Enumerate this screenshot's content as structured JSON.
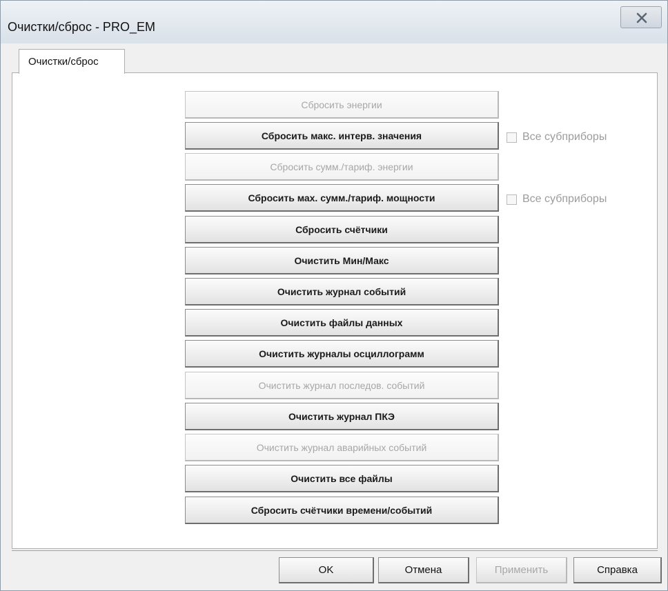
{
  "window": {
    "title": "Очистки/сброс - PRO_EM",
    "close_icon": "close-x-icon"
  },
  "tabs": [
    {
      "label": "Очистки/сброс",
      "active": true
    }
  ],
  "actions": [
    {
      "label": "Сбросить энергии",
      "enabled": false
    },
    {
      "label": "Сбросить макс. интерв. значения",
      "enabled": true
    },
    {
      "label": "Сбросить сумм./тариф. энергии",
      "enabled": false
    },
    {
      "label": "Сбросить мах. сумм./тариф. мощности",
      "enabled": true
    },
    {
      "label": "Сбросить счётчики",
      "enabled": true
    },
    {
      "label": "Очистить Мин/Макс",
      "enabled": true
    },
    {
      "label": "Очистить журнал событий",
      "enabled": true
    },
    {
      "label": "Очистить файлы данных",
      "enabled": true
    },
    {
      "label": "Очистить журналы осциллограмм",
      "enabled": true
    },
    {
      "label": "Очистить журнал последов. событий",
      "enabled": false
    },
    {
      "label": "Очистить журнал ПКЭ",
      "enabled": true
    },
    {
      "label": "Очистить журнал аварийных событий",
      "enabled": false
    },
    {
      "label": "Очистить все файлы",
      "enabled": true
    },
    {
      "label": "Сбросить счётчики времени/событий",
      "enabled": true
    }
  ],
  "checkboxes": [
    {
      "label": "Все субприборы",
      "checked": false,
      "enabled": false
    },
    {
      "label": "Все субприборы",
      "checked": false,
      "enabled": false
    }
  ],
  "footer": {
    "ok": "OK",
    "cancel": "Отмена",
    "apply": "Применить",
    "help": "Справка"
  }
}
